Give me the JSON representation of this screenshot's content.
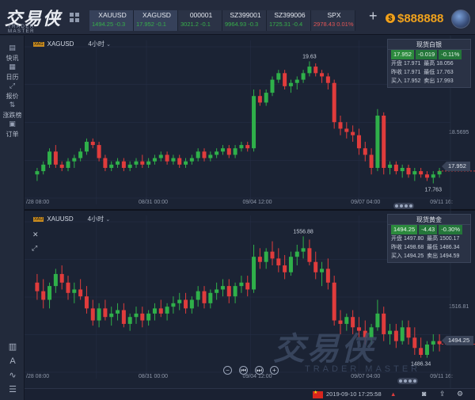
{
  "app": {
    "logo_text": "交易侠",
    "logo_sub": "TRADER MASTER",
    "balance": "$888888",
    "coin_symbol": "$",
    "plus": "+"
  },
  "quotes": [
    {
      "name": "XAUUSD",
      "price": "1494.25",
      "change": "-0.3",
      "dir": "dn"
    },
    {
      "name": "XAGUSD",
      "price": "17.952",
      "change": "-0.1",
      "dir": "dn"
    },
    {
      "name": "000001",
      "price": "3021.2",
      "change": "-0.1",
      "dir": "dn"
    },
    {
      "name": "SZ399001",
      "price": "9964.93",
      "change": "-0.3",
      "dir": "dn"
    },
    {
      "name": "SZ399006",
      "price": "1725.31",
      "change": "-0.4",
      "dir": "dn"
    },
    {
      "name": "SPX",
      "price": "2978.43",
      "change": "0.01%",
      "dir": "up"
    }
  ],
  "sidebar": [
    {
      "label": "快讯",
      "icon": "news-icon"
    },
    {
      "label": "日历",
      "icon": "calendar-icon"
    },
    {
      "label": "报价",
      "icon": "quote-icon"
    },
    {
      "label": "涨跌榜",
      "icon": "ranking-icon"
    },
    {
      "label": "订单",
      "icon": "order-icon"
    }
  ],
  "charts": [
    {
      "symbol": "XAGUSD",
      "badge": "XAG",
      "timeframe": "4小时",
      "panel": {
        "title": "现货白银",
        "price": "17.952",
        "change": "-0.019",
        "pct": "-0.11%",
        "open_label": "开盘",
        "open": "17.971",
        "high_label": "最高",
        "high": "18.056",
        "prev_label": "昨收",
        "prev": "17.971",
        "low_label": "最低",
        "low": "17.763",
        "buy_label": "买入",
        "buy": "17.952",
        "sell_label": "卖出",
        "sell": "17.993"
      },
      "last_price": "17.952",
      "high_mark": "19.63",
      "low_mark": "17.763",
      "ref_label": "18.5695",
      "xlabels": [
        {
          "t": "/28 08:00",
          "at": 0
        },
        {
          "t": "08/31 00:00",
          "at": 0.27
        },
        {
          "t": "09/04 12:00",
          "at": 0.52
        },
        {
          "t": "09/07 04:00",
          "at": 0.78
        },
        {
          "t": "09/11 16:",
          "at": 0.97
        }
      ]
    },
    {
      "symbol": "XAUUSD",
      "badge": "XAU",
      "timeframe": "4小时",
      "panel": {
        "title": "现货黄金",
        "price": "1494.25",
        "change": "-4.43",
        "pct": "-0.30%",
        "open_label": "开盘",
        "open": "1497.80",
        "high_label": "最高",
        "high": "1500.17",
        "prev_label": "昨收",
        "prev": "1498.68",
        "low_label": "最低",
        "low": "1486.34",
        "buy_label": "买入",
        "buy": "1494.25",
        "sell_label": "卖出",
        "sell": "1494.59"
      },
      "last_price": "1494.25",
      "high_mark": "1556.88",
      "low_mark": "1486.34",
      "ref_label": "1516.81",
      "xlabels": [
        {
          "t": "/28 08:00",
          "at": 0
        },
        {
          "t": "08/31 00:00",
          "at": 0.27
        },
        {
          "t": "09/04 12:00",
          "at": 0.52
        },
        {
          "t": "09/07 04:00",
          "at": 0.78
        },
        {
          "t": "09/11 16:",
          "at": 0.97
        }
      ]
    }
  ],
  "chart_data": [
    {
      "type": "candlestick",
      "symbol": "XAGUSD",
      "ohlc": [
        [
          17.9,
          18.0,
          17.8,
          17.95
        ],
        [
          17.95,
          18.1,
          17.9,
          18.05
        ],
        [
          18.05,
          18.3,
          18.0,
          18.25
        ],
        [
          18.25,
          18.35,
          18.0,
          18.05
        ],
        [
          18.05,
          18.1,
          17.95,
          18.0
        ],
        [
          18.0,
          18.15,
          17.95,
          18.1
        ],
        [
          18.1,
          18.2,
          18.0,
          18.15
        ],
        [
          18.15,
          18.3,
          18.1,
          18.25
        ],
        [
          18.25,
          18.45,
          18.2,
          18.4
        ],
        [
          18.4,
          18.45,
          18.3,
          18.35
        ],
        [
          18.35,
          18.4,
          18.1,
          18.15
        ],
        [
          18.15,
          18.2,
          17.95,
          18.0
        ],
        [
          18.0,
          18.1,
          17.95,
          18.05
        ],
        [
          18.05,
          18.15,
          18.0,
          18.1
        ],
        [
          18.1,
          18.15,
          17.95,
          18.0
        ],
        [
          18.0,
          18.1,
          17.95,
          18.05
        ],
        [
          18.05,
          18.15,
          18.0,
          18.1
        ],
        [
          18.1,
          18.2,
          18.0,
          18.05
        ],
        [
          18.05,
          18.15,
          18.0,
          18.1
        ],
        [
          18.1,
          18.2,
          18.05,
          18.15
        ],
        [
          18.15,
          18.25,
          18.1,
          18.2
        ],
        [
          18.2,
          18.25,
          18.05,
          18.1
        ],
        [
          18.1,
          18.2,
          18.05,
          18.15
        ],
        [
          18.15,
          18.2,
          18.0,
          18.05
        ],
        [
          18.05,
          18.15,
          18.0,
          18.1
        ],
        [
          18.1,
          18.2,
          18.05,
          18.15
        ],
        [
          18.15,
          18.3,
          18.1,
          18.25
        ],
        [
          18.25,
          18.3,
          18.1,
          18.15
        ],
        [
          18.15,
          18.25,
          18.1,
          18.2
        ],
        [
          18.2,
          18.3,
          18.15,
          18.25
        ],
        [
          18.25,
          18.35,
          18.2,
          18.3
        ],
        [
          18.3,
          18.35,
          18.15,
          18.2
        ],
        [
          18.2,
          18.35,
          18.15,
          18.3
        ],
        [
          18.3,
          18.4,
          18.25,
          18.35
        ],
        [
          18.35,
          18.4,
          18.25,
          18.3
        ],
        [
          18.3,
          19.2,
          18.25,
          19.1
        ],
        [
          19.1,
          19.2,
          18.95,
          19.0
        ],
        [
          19.0,
          19.2,
          18.95,
          19.15
        ],
        [
          19.15,
          19.4,
          19.1,
          19.35
        ],
        [
          19.35,
          19.5,
          19.3,
          19.45
        ],
        [
          19.45,
          19.5,
          19.2,
          19.25
        ],
        [
          19.25,
          19.35,
          19.15,
          19.3
        ],
        [
          19.3,
          19.4,
          19.2,
          19.35
        ],
        [
          19.35,
          19.5,
          19.3,
          19.45
        ],
        [
          19.45,
          19.63,
          19.4,
          19.55
        ],
        [
          19.55,
          19.6,
          19.4,
          19.45
        ],
        [
          19.45,
          19.5,
          19.3,
          19.4
        ],
        [
          19.4,
          19.45,
          19.2,
          19.3
        ],
        [
          19.3,
          19.35,
          18.6,
          18.7
        ],
        [
          18.7,
          18.8,
          18.5,
          18.6
        ],
        [
          18.6,
          18.7,
          18.45,
          18.55
        ],
        [
          18.55,
          18.65,
          18.4,
          18.5
        ],
        [
          18.5,
          18.6,
          18.2,
          18.3
        ],
        [
          18.3,
          18.4,
          18.1,
          18.2
        ],
        [
          18.2,
          18.3,
          17.9,
          18.0
        ],
        [
          18.0,
          18.9,
          17.95,
          18.8
        ],
        [
          18.8,
          18.85,
          17.9,
          18.0
        ],
        [
          18.0,
          18.1,
          17.9,
          18.05
        ],
        [
          18.05,
          18.1,
          17.9,
          17.95
        ],
        [
          17.95,
          18.05,
          17.85,
          18.0
        ],
        [
          18.0,
          18.05,
          17.85,
          17.9
        ],
        [
          17.9,
          18.0,
          17.8,
          17.95
        ],
        [
          17.95,
          18.0,
          17.85,
          17.9
        ],
        [
          17.9,
          17.95,
          17.8,
          17.85
        ],
        [
          17.85,
          17.95,
          17.763,
          17.9
        ],
        [
          17.9,
          18.0,
          17.85,
          17.952
        ]
      ]
    },
    {
      "type": "candlestick",
      "symbol": "XAUUSD",
      "ohlc": [
        [
          1530,
          1535,
          1520,
          1525
        ],
        [
          1525,
          1532,
          1515,
          1520
        ],
        [
          1520,
          1530,
          1515,
          1528
        ],
        [
          1528,
          1538,
          1524,
          1535
        ],
        [
          1535,
          1540,
          1526,
          1530
        ],
        [
          1530,
          1534,
          1520,
          1524
        ],
        [
          1524,
          1530,
          1518,
          1526
        ],
        [
          1526,
          1532,
          1520,
          1522
        ],
        [
          1522,
          1528,
          1512,
          1515
        ],
        [
          1515,
          1520,
          1505,
          1508
        ],
        [
          1508,
          1518,
          1504,
          1515
        ],
        [
          1515,
          1520,
          1508,
          1510
        ],
        [
          1510,
          1516,
          1505,
          1512
        ],
        [
          1512,
          1518,
          1508,
          1514
        ],
        [
          1514,
          1518,
          1504,
          1506
        ],
        [
          1506,
          1512,
          1502,
          1510
        ],
        [
          1510,
          1516,
          1506,
          1512
        ],
        [
          1512,
          1516,
          1504,
          1508
        ],
        [
          1508,
          1514,
          1505,
          1512
        ],
        [
          1512,
          1518,
          1508,
          1515
        ],
        [
          1515,
          1520,
          1510,
          1512
        ],
        [
          1512,
          1518,
          1508,
          1516
        ],
        [
          1516,
          1522,
          1512,
          1518
        ],
        [
          1518,
          1524,
          1514,
          1520
        ],
        [
          1520,
          1524,
          1512,
          1515
        ],
        [
          1515,
          1522,
          1512,
          1520
        ],
        [
          1520,
          1528,
          1516,
          1525
        ],
        [
          1525,
          1528,
          1515,
          1518
        ],
        [
          1518,
          1526,
          1515,
          1524
        ],
        [
          1524,
          1530,
          1520,
          1526
        ],
        [
          1526,
          1532,
          1522,
          1528
        ],
        [
          1528,
          1532,
          1518,
          1522
        ],
        [
          1522,
          1530,
          1518,
          1528
        ],
        [
          1528,
          1534,
          1524,
          1530
        ],
        [
          1530,
          1534,
          1522,
          1526
        ],
        [
          1526,
          1552,
          1524,
          1545
        ],
        [
          1545,
          1550,
          1538,
          1542
        ],
        [
          1542,
          1550,
          1538,
          1548
        ],
        [
          1548,
          1554,
          1540,
          1544
        ],
        [
          1544,
          1550,
          1536,
          1540
        ],
        [
          1540,
          1546,
          1532,
          1536
        ],
        [
          1536,
          1548,
          1534,
          1545
        ],
        [
          1545,
          1552,
          1540,
          1548
        ],
        [
          1548,
          1556.88,
          1544,
          1550
        ],
        [
          1550,
          1555,
          1540,
          1542
        ],
        [
          1542,
          1548,
          1532,
          1536
        ],
        [
          1536,
          1542,
          1528,
          1538
        ],
        [
          1538,
          1544,
          1526,
          1530
        ],
        [
          1530,
          1534,
          1505,
          1508
        ],
        [
          1508,
          1514,
          1500,
          1506
        ],
        [
          1506,
          1512,
          1502,
          1510
        ],
        [
          1510,
          1514,
          1500,
          1504
        ],
        [
          1504,
          1510,
          1498,
          1502
        ],
        [
          1502,
          1508,
          1494,
          1498
        ],
        [
          1498,
          1506,
          1494,
          1504
        ],
        [
          1504,
          1520,
          1502,
          1512
        ],
        [
          1512,
          1516,
          1496,
          1500
        ],
        [
          1500,
          1506,
          1494,
          1502
        ],
        [
          1502,
          1506,
          1492,
          1496
        ],
        [
          1496,
          1508,
          1494,
          1504
        ],
        [
          1504,
          1508,
          1494,
          1498
        ],
        [
          1498,
          1504,
          1488,
          1492
        ],
        [
          1492,
          1498,
          1486.34,
          1488
        ],
        [
          1488,
          1496,
          1486.34,
          1494
        ],
        [
          1494,
          1500,
          1490,
          1496
        ],
        [
          1496,
          1500,
          1490,
          1494.25
        ]
      ]
    }
  ],
  "status": {
    "datetime": "2019-09-10 17:25:58",
    "arrow": "▲"
  },
  "tools": [
    "✕",
    "⤢"
  ],
  "bottom_tools": [
    "⊏⊐",
    "A",
    "∿",
    "☰"
  ],
  "watermark": {
    "big": "交易侠",
    "small": "TRADER MASTER"
  },
  "colors": {
    "up": "#e03c3c",
    "down": "#2fb04a",
    "bg": "#1b2334"
  }
}
